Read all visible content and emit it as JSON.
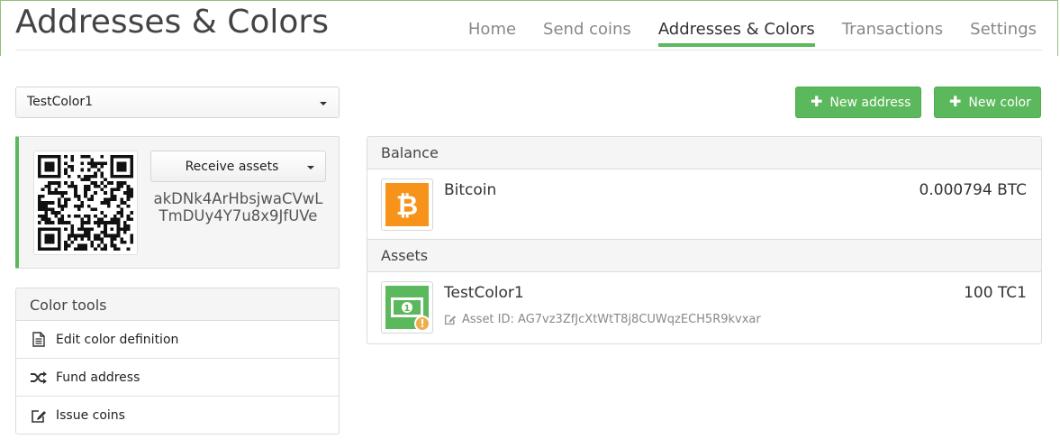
{
  "app": {
    "title": "Addresses & Colors"
  },
  "nav": {
    "items": [
      {
        "label": "Home",
        "active": false
      },
      {
        "label": "Send coins",
        "active": false
      },
      {
        "label": "Addresses & Colors",
        "active": true
      },
      {
        "label": "Transactions",
        "active": false
      },
      {
        "label": "Settings",
        "active": false
      }
    ]
  },
  "color_select": {
    "selected": "TestColor1"
  },
  "actions": {
    "new_address": "New address",
    "new_color": "New color"
  },
  "address_panel": {
    "receive_label": "Receive assets",
    "address": "akDNk4ArHbsjwaCVwLTmDUy4Y7u8x9JfUVe"
  },
  "color_tools": {
    "title": "Color tools",
    "items": [
      {
        "label": "Edit color definition",
        "icon": "file-icon"
      },
      {
        "label": "Fund address",
        "icon": "shuffle-icon"
      },
      {
        "label": "Issue coins",
        "icon": "edit-icon"
      }
    ]
  },
  "balance": {
    "title": "Balance",
    "bitcoin": {
      "name": "Bitcoin",
      "amount": "0.000794 BTC",
      "icon": "bitcoin-icon"
    }
  },
  "assets": {
    "title": "Assets",
    "items": [
      {
        "name": "TestColor1",
        "amount": "100 TC1",
        "asset_id_label": "Asset ID: AG7vz3ZfJcXtWtT8j8CUWqzECH5R9kvxar",
        "icon": "banknote-icon",
        "badge": "!"
      }
    ]
  },
  "colors": {
    "accent": "#5cb85c",
    "bitcoin": "#f7931a",
    "warning": "#f0ad4e"
  }
}
